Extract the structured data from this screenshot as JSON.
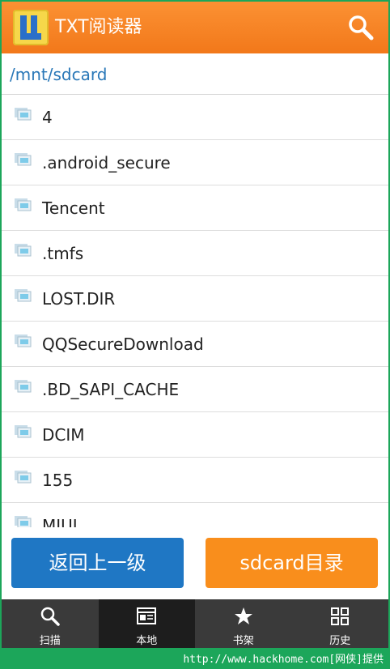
{
  "header": {
    "title": "TXT阅读器",
    "search_icon": "search-icon"
  },
  "path": "/mnt/sdcard",
  "files": [
    {
      "name": "4"
    },
    {
      "name": ".android_secure"
    },
    {
      "name": "Tencent"
    },
    {
      "name": ".tmfs"
    },
    {
      "name": "LOST.DIR"
    },
    {
      "name": "QQSecureDownload"
    },
    {
      "name": ".BD_SAPI_CACHE"
    },
    {
      "name": "DCIM"
    },
    {
      "name": "155"
    },
    {
      "name": "MIUI"
    }
  ],
  "buttons": {
    "back": "返回上一级",
    "sdcard": "sdcard目录"
  },
  "tabs": [
    {
      "label": "扫描",
      "icon": "search-icon"
    },
    {
      "label": "本地",
      "icon": "document-icon",
      "active": true
    },
    {
      "label": "书架",
      "icon": "star-icon"
    },
    {
      "label": "历史",
      "icon": "grid-icon"
    }
  ],
  "watermark": "http://www.hackhome.com[网侠]提供",
  "colors": {
    "header": "#f7811f",
    "back_button": "#1f77c4",
    "sdcard_button": "#f98e1c",
    "path": "#2a78b8",
    "tabbar": "#3a3a3a",
    "border": "#1ca65a"
  }
}
